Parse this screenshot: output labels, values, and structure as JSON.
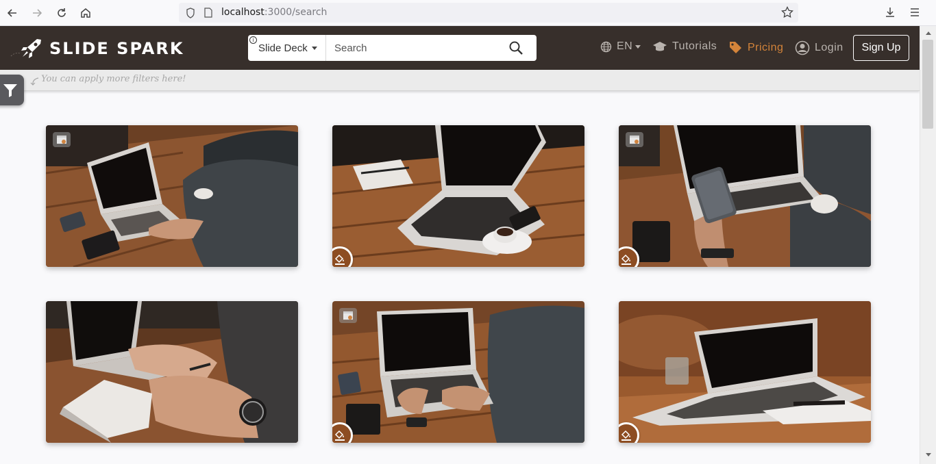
{
  "browser": {
    "url_host": "localhost",
    "url_path": ":3000/search"
  },
  "header": {
    "brand": "SLIDE SPARK",
    "search": {
      "type_label": "Slide Deck",
      "placeholder": "Search",
      "info": "i"
    },
    "language": "EN",
    "tutorials": "Tutorials",
    "pricing": "Pricing",
    "login": "Login",
    "signup": "Sign Up"
  },
  "filters": {
    "hint": "You can apply more filters here!"
  },
  "colors": {
    "header_bg": "#372f2b",
    "accent": "#d4843a",
    "edit_badge": "#8d4d22"
  },
  "results": [
    {
      "name": "laptop-typing-desk",
      "video_icon": "video-icon",
      "edit_icon": "none"
    },
    {
      "name": "laptop-notebook-coffee",
      "video_icon": "none",
      "edit_icon": "fill-icon"
    },
    {
      "name": "laptop-phone-hand",
      "video_icon": "video-icon",
      "edit_icon": "fill-icon"
    },
    {
      "name": "notebook-watch-writing",
      "video_icon": "none",
      "edit_icon": "none"
    },
    {
      "name": "laptop-typing-phone",
      "video_icon": "video-icon",
      "edit_icon": "fill-icon"
    },
    {
      "name": "laptop-glass-table",
      "video_icon": "none",
      "edit_icon": "fill-icon"
    }
  ]
}
